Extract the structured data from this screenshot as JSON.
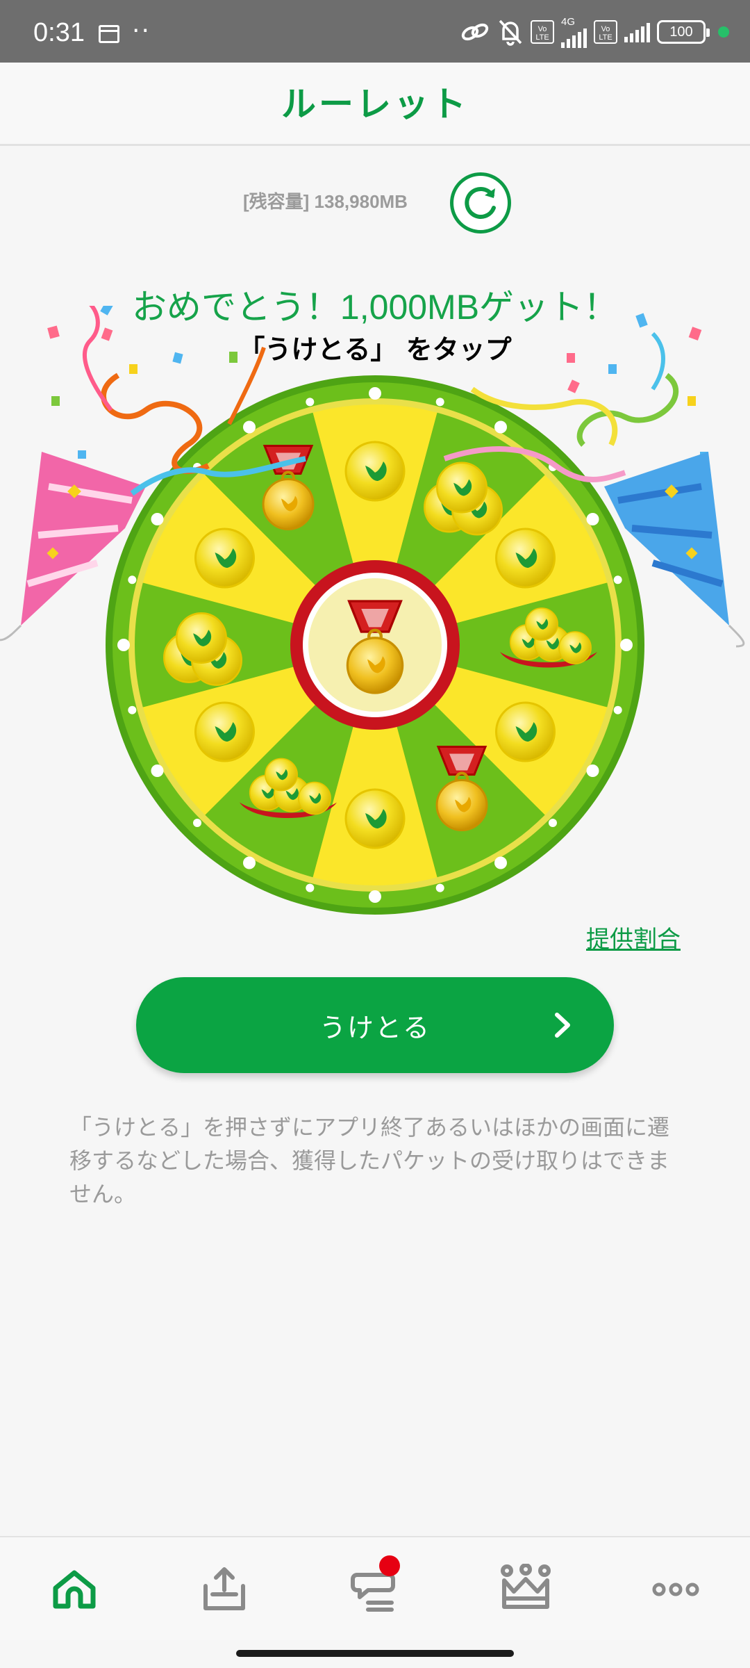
{
  "status_bar": {
    "time": "0:31",
    "dots": "··",
    "volte1": "Vo LTE",
    "network": "4G",
    "volte2": "Vo LTE",
    "battery": "100"
  },
  "header": {
    "title": "ルーレット"
  },
  "remaining": {
    "text": "[残容量] 138,980MB"
  },
  "result": {
    "congrats": "おめでとう！1,000MBゲット！",
    "instruction": "「うけとる」 をタップ"
  },
  "wheel": {
    "segments": [
      "coin",
      "coins-pile",
      "coin",
      "coins-bag",
      "coin",
      "medal",
      "coin",
      "coins-bag",
      "coin",
      "coins-pile",
      "coin",
      "medal"
    ],
    "colors": {
      "green": "#6cbf1b",
      "yellow": "#fbe62a",
      "rim": "#5fb81a",
      "center_ring": "#c8141e"
    }
  },
  "links": {
    "offer_rate": "提供割合"
  },
  "claim_button": {
    "label": "うけとる"
  },
  "notice": "「うけとる」を押さずにアプリ終了あるいはほかの画面に遷移するなどした場合、獲得したパケットの受け取りはできません。",
  "bottom_nav": {
    "items": [
      {
        "icon": "home-icon",
        "active": true
      },
      {
        "icon": "upload-icon",
        "active": false
      },
      {
        "icon": "message-icon",
        "active": false,
        "badge": true
      },
      {
        "icon": "crown-icon",
        "active": false
      },
      {
        "icon": "more-icon",
        "active": false
      }
    ]
  },
  "colors": {
    "accent": "#0d9b46",
    "button": "#0ba443",
    "badge": "#e60012"
  }
}
